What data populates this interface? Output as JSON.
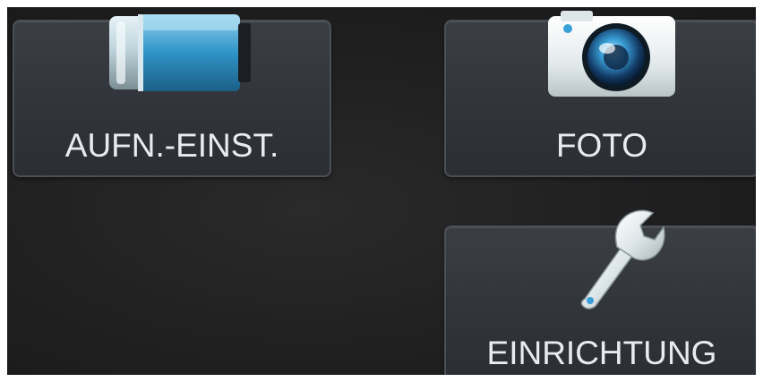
{
  "menu": {
    "items": [
      {
        "id": "aufn",
        "label": "AUFN.-EINST.",
        "icon": "camcorder-icon"
      },
      {
        "id": "foto",
        "label": "FOTO",
        "icon": "camera-icon"
      },
      {
        "id": "einrichtung",
        "label": "EINRICHTUNG",
        "icon": "wrench-icon"
      }
    ]
  },
  "colors": {
    "background": "#1f1f20",
    "tile": "#33373c",
    "tile_border": "#4a4e55",
    "label": "#e9ecef",
    "accent_blue": "#3aa0d8"
  }
}
